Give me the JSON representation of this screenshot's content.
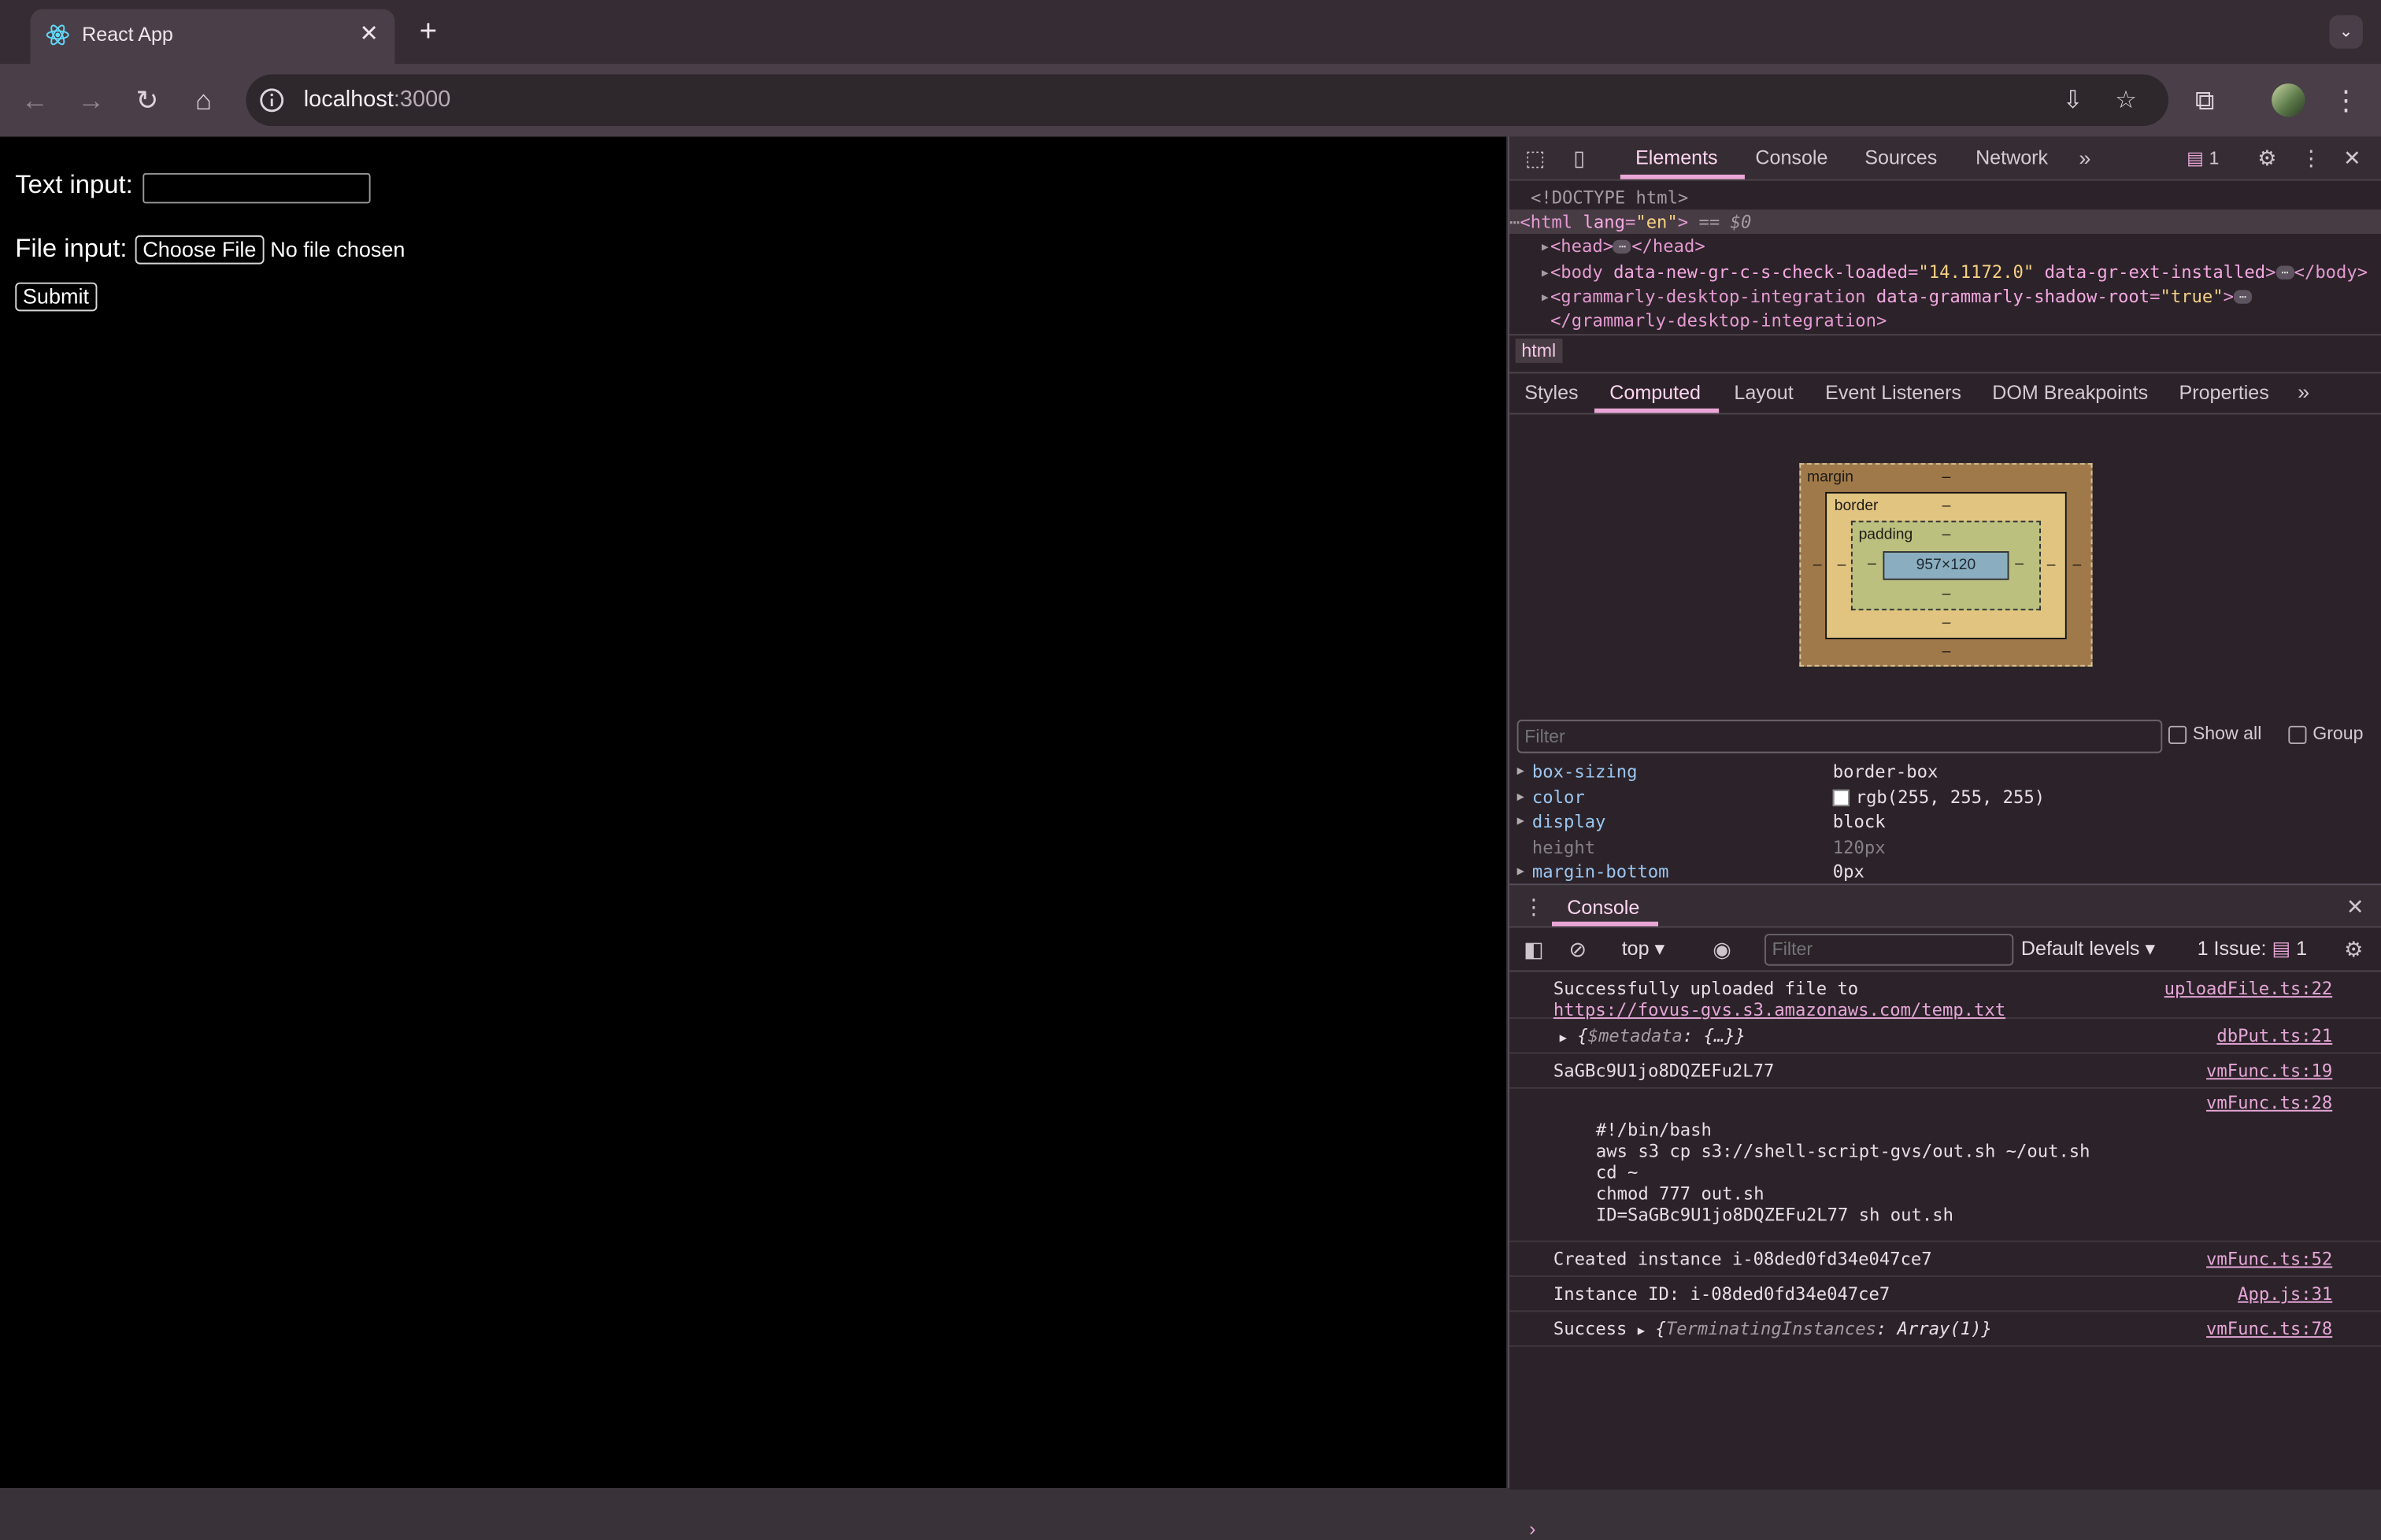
{
  "browser": {
    "tab_title": "React App",
    "url_host": "localhost",
    "url_port": ":3000"
  },
  "page": {
    "text_input_label": "Text input:",
    "text_input_value": "",
    "file_input_label": "File input:",
    "choose_file_label": "Choose File",
    "file_status": "No file chosen",
    "submit_label": "Submit"
  },
  "devtools": {
    "tabs": [
      "Elements",
      "Console",
      "Sources",
      "Network"
    ],
    "issues_badge": "1",
    "dom": {
      "doctype": "<!DOCTYPE html>",
      "html_tag": "<html",
      "html_attr": "lang",
      "html_val": "\"en\"",
      "html_close": ">",
      "html_suffix": "== $0",
      "head_open": "<head>",
      "head_close": "</head>",
      "body_open": "<body",
      "body_attr1": "data-new-gr-c-s-check-loaded",
      "body_val1": "\"14.1172.0\"",
      "body_attr2": "data-gr-ext-installed",
      "body_end": ">",
      "body_close": "</body>",
      "gram_open": "<grammarly-desktop-integration",
      "gram_attr": "data-grammarly-shadow-root",
      "gram_val": "\"true\"",
      "gram_end": ">",
      "gram_close": "</grammarly-desktop-integration>"
    },
    "breadcrumb": "html",
    "subtabs": [
      "Styles",
      "Computed",
      "Layout",
      "Event Listeners",
      "DOM Breakpoints",
      "Properties"
    ],
    "box_model": {
      "margin_label": "margin",
      "border_label": "border",
      "padding_label": "padding",
      "content": "957×120",
      "dash": "–"
    },
    "filter_placeholder": "Filter",
    "show_all_label": "Show all",
    "group_label": "Group",
    "computed": [
      {
        "name": "box-sizing",
        "value": "border-box"
      },
      {
        "name": "color",
        "value": "rgb(255, 255, 255)"
      },
      {
        "name": "display",
        "value": "block"
      },
      {
        "name": "height",
        "value": "120px"
      },
      {
        "name": "margin-bottom",
        "value": "0px"
      }
    ],
    "drawer": {
      "tab": "Console",
      "context": "top",
      "filter_placeholder": "Filter",
      "levels": "Default levels",
      "issues_label": "1 Issue:",
      "issues_count": "1",
      "logs": [
        {
          "line1": "Successfully uploaded file to",
          "link": "https://fovus-gvs.s3.amazonaws.com/temp.txt",
          "src": "uploadFile.ts:22"
        },
        {
          "text": "$metadata",
          "rest": ": {…}}",
          "src": "dbPut.ts:21"
        },
        {
          "text": "SaGBc9U1jo8DQZEFu2L77",
          "src": "vmFunc.ts:19"
        },
        {
          "text": "#!/bin/bash\naws s3 cp s3://shell-script-gvs/out.sh ~/out.sh\ncd ~\nchmod 777 out.sh\nID=SaGBc9U1jo8DQZEFu2L77 sh out.sh",
          "src": "vmFunc.ts:28"
        },
        {
          "text": "Created instance i-08ded0fd34e047ce7",
          "src": "vmFunc.ts:52"
        },
        {
          "text": "Instance ID: i-08ded0fd34e047ce7",
          "src": "App.js:31"
        },
        {
          "text": "Success",
          "obj_key": "TerminatingInstances",
          "obj_val": ": Array(1)}",
          "src": "vmFunc.ts:78"
        }
      ]
    }
  }
}
